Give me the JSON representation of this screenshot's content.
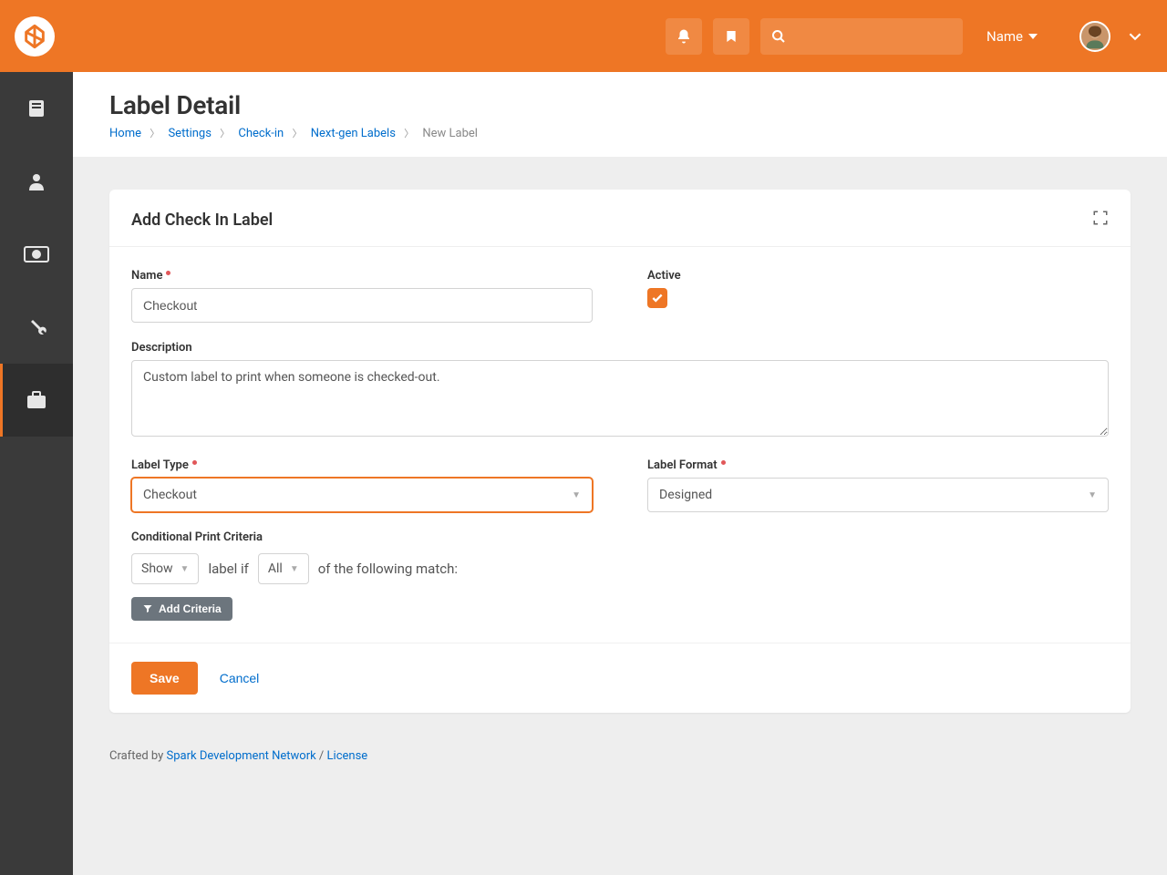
{
  "topbar": {
    "name_select": "Name"
  },
  "page": {
    "title": "Label Detail"
  },
  "breadcrumb": {
    "items": [
      "Home",
      "Settings",
      "Check-in",
      "Next-gen Labels"
    ],
    "current": "New Label"
  },
  "panel": {
    "title": "Add Check In Label"
  },
  "form": {
    "name_label": "Name",
    "name_value": "Checkout",
    "active_label": "Active",
    "active_checked": true,
    "description_label": "Description",
    "description_value": "Custom label to print when someone is checked-out.",
    "label_type_label": "Label Type",
    "label_type_value": "Checkout",
    "label_format_label": "Label Format",
    "label_format_value": "Designed",
    "criteria_label": "Conditional Print Criteria",
    "criteria_show": "Show",
    "criteria_text1": "label if",
    "criteria_all": "All",
    "criteria_text2": "of the following match:",
    "add_criteria_label": "Add Criteria"
  },
  "actions": {
    "save": "Save",
    "cancel": "Cancel"
  },
  "footer": {
    "crafted_by": "Crafted by ",
    "org": "Spark Development Network",
    "sep": " / ",
    "license": "License"
  }
}
